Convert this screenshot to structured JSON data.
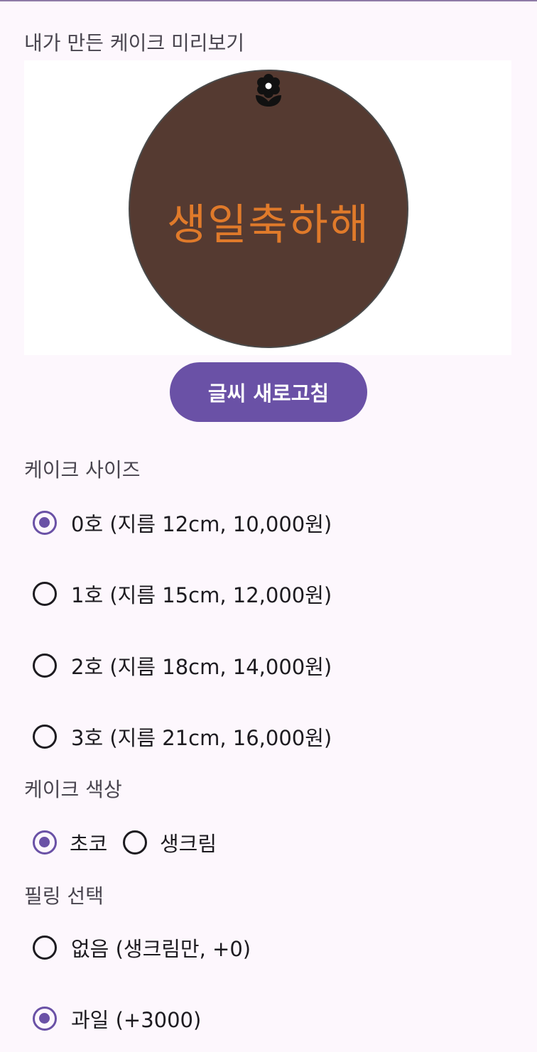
{
  "preview": {
    "title": "내가 만든 케이크 미리보기",
    "cake_text": "생일축하해",
    "cake_color": "#553a31",
    "text_color": "#e07a2a",
    "topping_icon": "flower-icon"
  },
  "refresh_button": {
    "label": "글씨 새로고침"
  },
  "size": {
    "label": "케이크 사이즈",
    "options": [
      {
        "label": "0호 (지름 12cm, 10,000원)",
        "selected": true
      },
      {
        "label": "1호 (지름 15cm, 12,000원)",
        "selected": false
      },
      {
        "label": "2호 (지름 18cm, 14,000원)",
        "selected": false
      },
      {
        "label": "3호 (지름 21cm, 16,000원)",
        "selected": false
      }
    ]
  },
  "color": {
    "label": "케이크 색상",
    "options": [
      {
        "label": "초코",
        "selected": true
      },
      {
        "label": "생크림",
        "selected": false
      }
    ]
  },
  "filling": {
    "label": "필링 선택",
    "options": [
      {
        "label": "없음 (생크림만, +0)",
        "selected": false
      },
      {
        "label": "과일 (+3000)",
        "selected": true
      }
    ]
  },
  "accent_color": "#6a51a6"
}
